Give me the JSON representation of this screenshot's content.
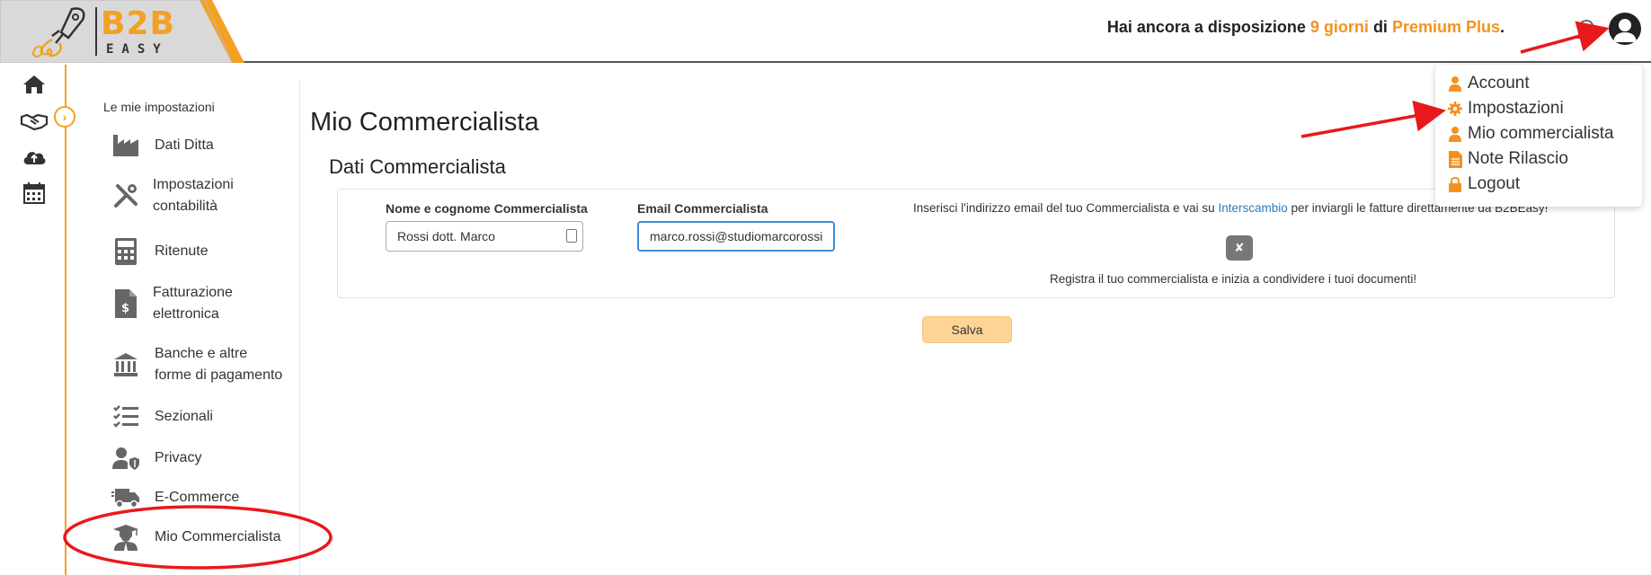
{
  "header": {
    "logo_text": "B2B",
    "logo_sub": "EASY",
    "trial_prefix": "Hai ancora a disposizione ",
    "trial_days": "9 giorni",
    "trial_mid": " di ",
    "trial_plan": "Premium Plus",
    "trial_suffix": "."
  },
  "rail": {
    "icons": [
      "home-icon",
      "handshake-icon",
      "cloud-upload-icon",
      "calendar-icon"
    ]
  },
  "submenu": {
    "title": "Le mie impostazioni",
    "items": [
      {
        "label": "Dati Ditta",
        "icon": "factory-icon"
      },
      {
        "label": "Impostazioni contabilità",
        "line1": "Impostazioni",
        "line2": "contabilità",
        "icon": "tools-icon"
      },
      {
        "label": "Ritenute",
        "icon": "calculator-icon"
      },
      {
        "label": "Fatturazione elettronica",
        "line1": "Fatturazione",
        "line2": "elettronica",
        "icon": "invoice-icon"
      },
      {
        "label": "Banche e altre forme di pagamento",
        "line1": "Banche e altre",
        "line2": "forme di pagamento",
        "icon": "bank-icon"
      },
      {
        "label": "Sezionali",
        "icon": "checklist-icon"
      },
      {
        "label": "Privacy",
        "icon": "user-shield-icon"
      },
      {
        "label": "E-Commerce",
        "icon": "shipping-truck-icon"
      },
      {
        "label": "Mio Commercialista",
        "icon": "graduate-icon"
      }
    ]
  },
  "main": {
    "page_title": "Mio Commercialista",
    "section_title": "Dati Commercialista",
    "name_label": "Nome e cognome Commercialista",
    "name_value": "Rossi dott. Marco",
    "email_label": "Email Commercialista",
    "email_value": "marco.rossi@studiomarcorossi.",
    "info_prefix": "Inserisci l'indirizzo email del tuo Commercialista e vai su ",
    "info_link": "Interscambio",
    "info_suffix": " per inviargli le fatture direttamente da B2BEasy!",
    "register_text": "Registra il tuo commercialista e inizia a condividere i tuoi documenti!",
    "save_label": "Salva"
  },
  "dropdown": {
    "items": [
      {
        "label": "Account",
        "icon": "user-icon"
      },
      {
        "label": "Impostazioni",
        "icon": "gear-icon"
      },
      {
        "label": "Mio commercialista",
        "icon": "user-icon"
      },
      {
        "label": "Note Rilascio",
        "icon": "document-icon"
      },
      {
        "label": "Logout",
        "icon": "lock-icon"
      }
    ]
  },
  "colors": {
    "accent": "#f4a024",
    "highlight": "#f4921e",
    "link": "#2a7dc0",
    "annotation": "#e8191d"
  }
}
